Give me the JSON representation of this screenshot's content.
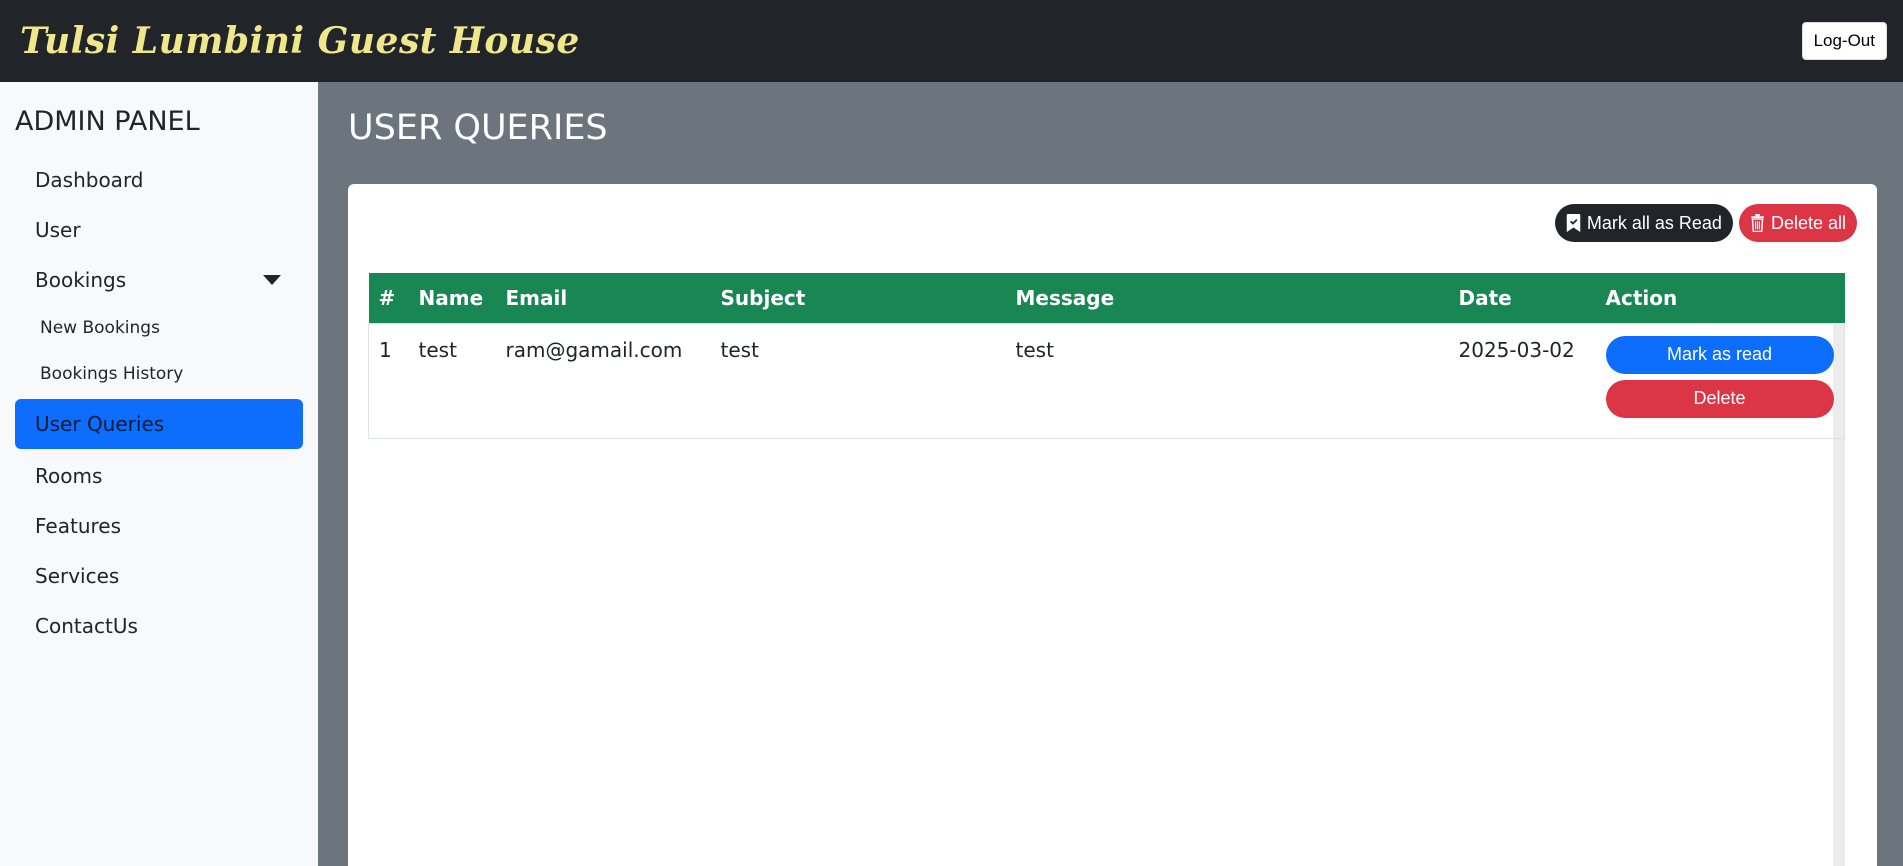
{
  "header": {
    "brand": "Tulsi Lumbini Guest House",
    "logout_label": "Log-Out"
  },
  "sidebar": {
    "title": "ADMIN PANEL",
    "items": [
      {
        "label": "Dashboard"
      },
      {
        "label": "User"
      },
      {
        "label": "Bookings"
      },
      {
        "label": "New Bookings"
      },
      {
        "label": "Bookings History"
      },
      {
        "label": "User Queries"
      },
      {
        "label": "Rooms"
      },
      {
        "label": "Features"
      },
      {
        "label": "Services"
      },
      {
        "label": "ContactUs"
      }
    ]
  },
  "main": {
    "title": "USER QUERIES",
    "mark_all_label": "Mark all as Read",
    "delete_all_label": "Delete all",
    "table": {
      "headers": [
        "#",
        "Name",
        "Email",
        "Subject",
        "Message",
        "Date",
        "Action"
      ],
      "rows": [
        {
          "num": "1",
          "name": "test",
          "email": "ram@gamail.com",
          "subject": "test",
          "message": "test",
          "date": "2025-03-02",
          "mark_read_label": "Mark as read",
          "delete_label": "Delete"
        }
      ]
    }
  },
  "colors": {
    "topbar": "#212529",
    "brand": "#f0e68c",
    "content_bg": "#6c757d",
    "table_header": "#198754",
    "primary": "#0d6efd",
    "danger": "#dc3545"
  },
  "icons": {
    "mark_all": "bookmark-check-icon",
    "delete_all": "trash-icon",
    "bookings_toggle": "caret-down-icon"
  }
}
